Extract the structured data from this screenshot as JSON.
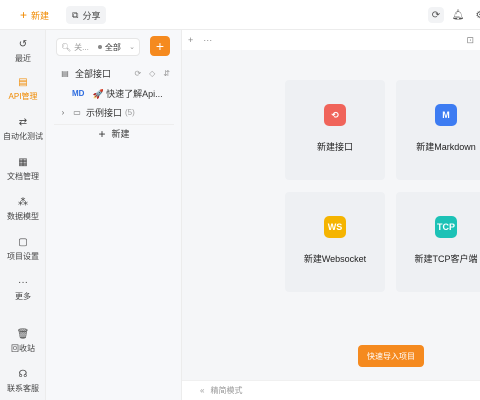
{
  "topbar": {
    "new_label": "新建",
    "share_label": "分享",
    "icons": [
      "refresh-icon",
      "bell-icon",
      "settings-icon"
    ]
  },
  "leftnav": {
    "items": [
      {
        "label": "最近",
        "icon": "history-icon"
      },
      {
        "label": "API管理",
        "icon": "api-doc-icon",
        "active": true
      },
      {
        "label": "自动化测试",
        "icon": "swap-icon"
      },
      {
        "label": "文档管理",
        "icon": "document-icon"
      },
      {
        "label": "数据模型",
        "icon": "model-icon"
      },
      {
        "label": "项目设置",
        "icon": "project-settings-icon"
      },
      {
        "label": "更多",
        "icon": "more-icon"
      },
      {
        "label": "回收站",
        "icon": "trash-icon"
      },
      {
        "label": "联系客服",
        "icon": "headset-icon"
      }
    ]
  },
  "tree": {
    "search_placeholder": "关...",
    "filter_value": "全部",
    "add_label": "+",
    "root_label": "全部接口",
    "md_tag": "MD",
    "md_item_label": "🚀 快速了解Api...",
    "folder_label": "示例接口",
    "folder_count": "(5)",
    "new_label": "新建"
  },
  "main": {
    "tab_add": "+",
    "tab_more": "···",
    "cards": [
      {
        "label": "新建接口",
        "icon_text": "⟲",
        "color": "#f0645a"
      },
      {
        "label": "新建Markdown",
        "icon_text": "M",
        "color": "#3d7cf2"
      },
      {
        "label": "新建Websocket",
        "icon_text": "WS",
        "color": "#f5b400"
      },
      {
        "label": "新建TCP客户端",
        "icon_text": "TCP",
        "color": "#1cc2b6"
      }
    ],
    "import_label": "快速导入项目",
    "status_label": "精简模式"
  },
  "colors": {
    "accent": "#f58a1f"
  }
}
